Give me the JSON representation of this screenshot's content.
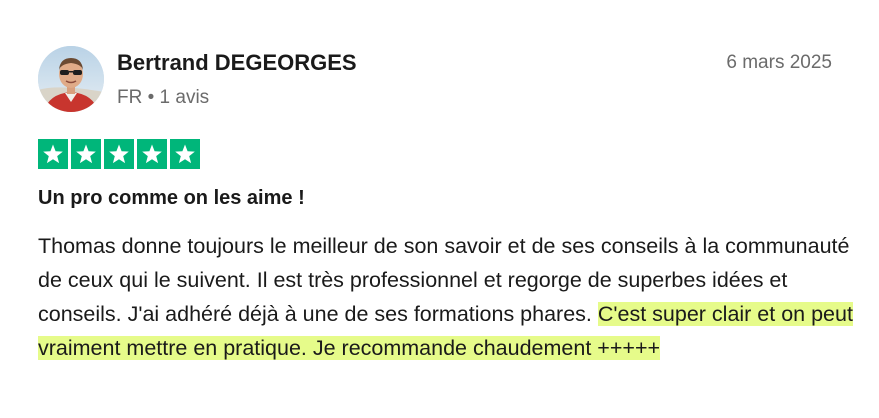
{
  "review": {
    "author": {
      "name": "Bertrand DEGEORGES",
      "country": "FR",
      "separator": "•",
      "review_count": "1 avis"
    },
    "date": "6 mars 2025",
    "rating": 5,
    "rating_max": 5,
    "star_color": "#00b67a",
    "title": "Un pro comme on les aime !",
    "body_plain": "Thomas donne toujours le meilleur de son savoir et de ses conseils à la communauté de ceux qui le suivent. Il est très professionnel et regorge de superbes idées et conseils. J'ai adhéré déjà à une de ses formations phares.",
    "body_highlighted": "C'est super clair et on peut vraiment mettre en pratique. Je recommande chaudement +++++",
    "highlight_color": "#e6fb8a"
  }
}
